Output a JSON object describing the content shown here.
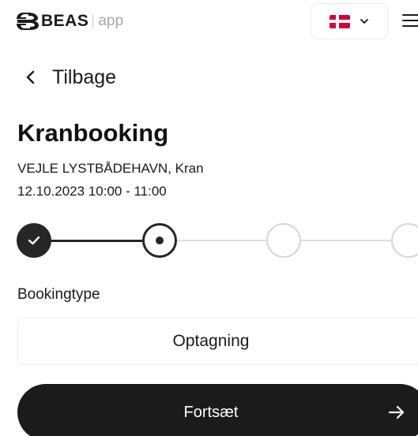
{
  "header": {
    "logo_text": "BEAS",
    "logo_app": "app",
    "language": "da",
    "icons": {
      "logo": "beas-logo-icon",
      "flag": "denmark-flag-icon",
      "chevron": "chevron-down-icon",
      "menu": "hamburger-menu-icon"
    }
  },
  "back": {
    "label": "Tilbage",
    "icon": "chevron-left-icon"
  },
  "booking": {
    "title": "Kranbooking",
    "location": "VEJLE LYSTBÅDEHAVN, Kran",
    "datetime": "12.10.2023 10:00 - 11:00"
  },
  "stepper": {
    "current_step": 2,
    "steps": [
      {
        "state": "done"
      },
      {
        "state": "current"
      },
      {
        "state": "upcoming"
      },
      {
        "state": "upcoming"
      }
    ]
  },
  "form": {
    "bookingtype_label": "Bookingtype",
    "bookingtype_value": "Optagning"
  },
  "actions": {
    "continue_label": "Fortsæt",
    "continue_icon": "arrow-right-icon"
  },
  "colors": {
    "primary": "#1b1b1b",
    "border": "#ececec",
    "inactive_step": "#d6d6d6",
    "flag_red": "#d4003a"
  }
}
